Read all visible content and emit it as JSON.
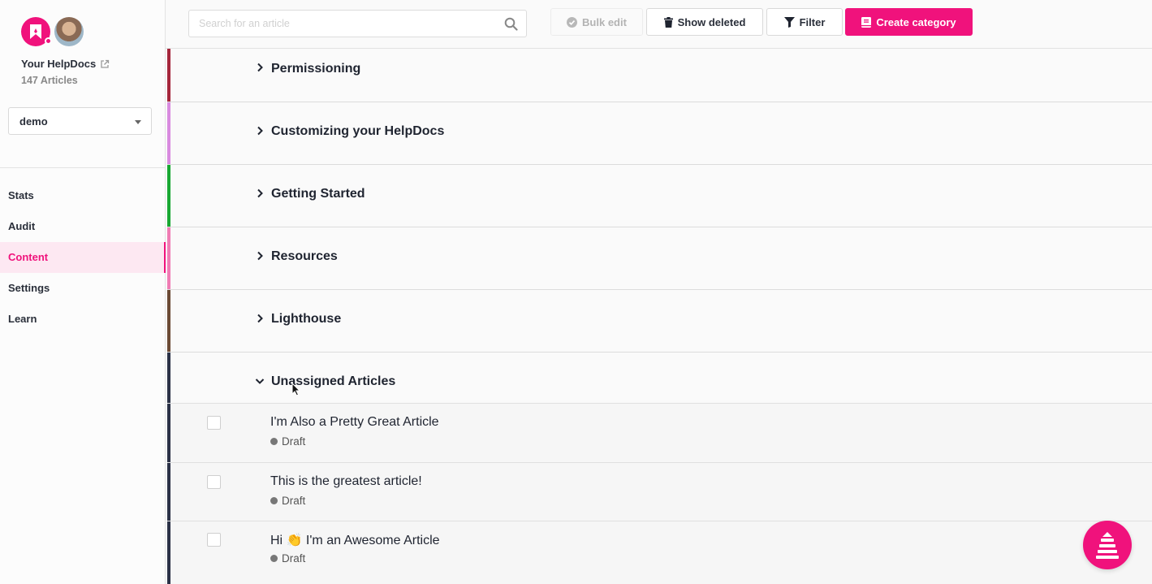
{
  "sidebar": {
    "site_name": "Your HelpDocs",
    "article_count": "147 Articles",
    "site_select": "demo",
    "nav": [
      {
        "label": "Stats"
      },
      {
        "label": "Audit"
      },
      {
        "label": "Content",
        "active": true
      },
      {
        "label": "Settings"
      },
      {
        "label": "Learn"
      }
    ]
  },
  "toolbar": {
    "search_placeholder": "Search for an article",
    "bulk_edit": "Bulk edit",
    "show_deleted": "Show deleted",
    "filter": "Filter",
    "create_category": "Create category"
  },
  "categories": [
    {
      "title": "Permissioning",
      "color": "#a5263b",
      "expanded": false
    },
    {
      "title": "Customizing your HelpDocs",
      "color": "#d98be0",
      "expanded": false
    },
    {
      "title": "Getting Started",
      "color": "#19a833",
      "expanded": false
    },
    {
      "title": "Resources",
      "color": "#f07cb4",
      "expanded": false
    },
    {
      "title": "Lighthouse",
      "color": "#6b4a35",
      "expanded": false
    },
    {
      "title": "Unassigned Articles",
      "color": "#2b3247",
      "expanded": true
    }
  ],
  "articles": [
    {
      "title": "I'm Also a Pretty Great Article",
      "status": "Draft"
    },
    {
      "title": "This is the greatest article!",
      "status": "Draft"
    },
    {
      "title": "Hi 👏 I'm an Awesome Article",
      "status": "Draft"
    }
  ],
  "colors": {
    "brand": "#f0127c",
    "active_nav_bg": "#fde8f2"
  }
}
